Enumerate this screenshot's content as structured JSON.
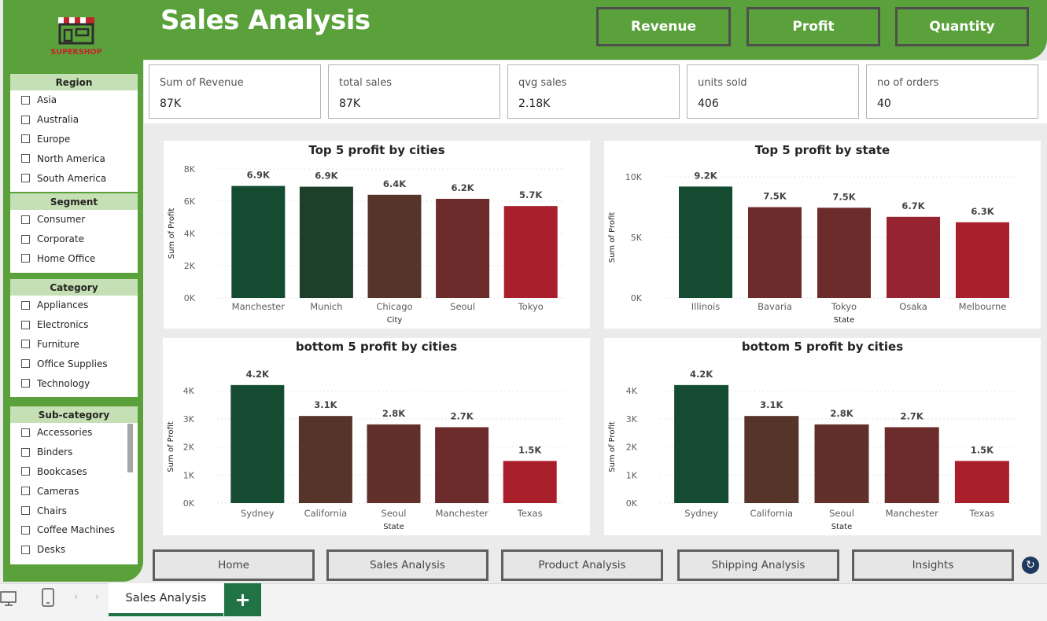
{
  "header": {
    "title": "Sales Analysis",
    "buttons": [
      "Revenue",
      "Profit",
      "Quantity"
    ]
  },
  "logo": {
    "text": "SUPERSHOP",
    "icon": "shop-icon"
  },
  "slicers": [
    {
      "title": "Region",
      "items": [
        "Asia",
        "Australia",
        "Europe",
        "North America",
        "South America"
      ]
    },
    {
      "title": "Segment",
      "items": [
        "Consumer",
        "Corporate",
        "Home Office"
      ]
    },
    {
      "title": "Category",
      "items": [
        "Appliances",
        "Electronics",
        "Furniture",
        "Office Supplies",
        "Technology"
      ]
    },
    {
      "title": "Sub-category",
      "items": [
        "Accessories",
        "Binders",
        "Bookcases",
        "Cameras",
        "Chairs",
        "Coffee Machines",
        "Desks"
      ]
    }
  ],
  "kpis": [
    {
      "label": "Sum of Revenue",
      "value": "87K"
    },
    {
      "label": "total sales",
      "value": "87K"
    },
    {
      "label": "qvg sales",
      "value": "2.18K"
    },
    {
      "label": "units sold",
      "value": "406"
    },
    {
      "label": "no of orders",
      "value": "40"
    }
  ],
  "colors": {
    "header_green": "#5aa13c",
    "light_green": "#c5e0b4",
    "accent_tab": "#217346"
  },
  "chart_data": [
    {
      "type": "bar",
      "title": "Top 5 profit by cities",
      "xlabel": "City",
      "ylabel": "Sum of Profit",
      "categories": [
        "Manchester",
        "Munich",
        "Chicago",
        "Seoul",
        "Tokyo"
      ],
      "values": [
        6950,
        6900,
        6400,
        6150,
        5700
      ],
      "data_labels": [
        "6.9K",
        "6.9K",
        "6.4K",
        "6.2K",
        "5.7K"
      ],
      "yticks": [
        "0K",
        "2K",
        "4K",
        "6K",
        "8K"
      ],
      "ylim": [
        0,
        8000
      ],
      "colors": [
        "#154b30",
        "#1e402b",
        "#56342a",
        "#6c2c2c",
        "#a91f2b"
      ]
    },
    {
      "type": "bar",
      "title": "Top 5 profit by state",
      "xlabel": "State",
      "ylabel": "Sum of Profit",
      "categories": [
        "Illinois",
        "Bavaria",
        "Tokyo",
        "Osaka",
        "Melbourne"
      ],
      "values": [
        9200,
        7500,
        7450,
        6700,
        6250
      ],
      "data_labels": [
        "9.2K",
        "7.5K",
        "7.5K",
        "6.7K",
        "6.3K"
      ],
      "yticks": [
        "0K",
        "5K",
        "10K"
      ],
      "ylim": [
        0,
        10000
      ],
      "colors": [
        "#154b30",
        "#6c2c2c",
        "#6c2c2c",
        "#962430",
        "#a91f2b"
      ]
    },
    {
      "type": "bar",
      "title": "bottom 5 profit by cities",
      "xlabel": "State",
      "ylabel": "Sum of Profit",
      "categories": [
        "Sydney",
        "California",
        "Seoul",
        "Manchester",
        "Texas"
      ],
      "values": [
        4200,
        3100,
        2800,
        2700,
        1500
      ],
      "data_labels": [
        "4.2K",
        "3.1K",
        "2.8K",
        "2.7K",
        "1.5K"
      ],
      "yticks": [
        "0K",
        "1K",
        "2K",
        "3K",
        "4K"
      ],
      "ylim": [
        0,
        4000
      ],
      "colors": [
        "#154b30",
        "#56342a",
        "#62302b",
        "#6c2c2c",
        "#a91f2b"
      ]
    },
    {
      "type": "bar",
      "title": "bottom 5 profit by cities",
      "xlabel": "State",
      "ylabel": "Sum of Profit",
      "categories": [
        "Sydney",
        "California",
        "Seoul",
        "Manchester",
        "Texas"
      ],
      "values": [
        4200,
        3100,
        2800,
        2700,
        1500
      ],
      "data_labels": [
        "4.2K",
        "3.1K",
        "2.8K",
        "2.7K",
        "1.5K"
      ],
      "yticks": [
        "0K",
        "1K",
        "2K",
        "3K",
        "4K"
      ],
      "ylim": [
        0,
        4000
      ],
      "colors": [
        "#154b30",
        "#56342a",
        "#62302b",
        "#6c2c2c",
        "#a91f2b"
      ]
    }
  ],
  "nav": [
    "Home",
    "Sales Analysis",
    "Product Analysis",
    "Shipping Analysis",
    "Insights"
  ],
  "tabbar": {
    "page_tab": "Sales Analysis",
    "add_label": "+"
  }
}
